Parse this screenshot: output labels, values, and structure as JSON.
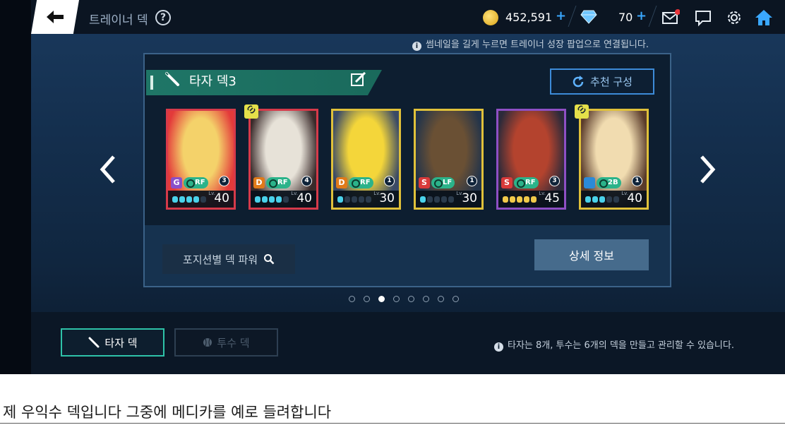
{
  "header": {
    "title": "트레이너 덱",
    "help_icon": "question-circle-icon",
    "coins": "452,591",
    "gems": "70",
    "plus_label": "+",
    "icons": [
      "mail-icon",
      "chat-icon",
      "gear-icon",
      "home-icon"
    ],
    "mail_badge_color": "#e8343a"
  },
  "notice": "썸네일을 길게 누르면 트레이너 성장 팝업으로 연결됩니다.",
  "deck": {
    "name": "타자 덱3",
    "recommend_label": "추천 구성",
    "power_label": "포지션별 덱 파워",
    "detail_label": "상세 정보"
  },
  "cards": [
    {
      "grade": "G",
      "grade_color": "#8a4fc9",
      "position": "RF",
      "level_badge": "3",
      "level": "40",
      "frame_color": "#d63a4a",
      "stars": 4,
      "star_style": "on",
      "linked": false
    },
    {
      "grade": "D",
      "grade_color": "#e07a1a",
      "position": "RF",
      "level_badge": "4",
      "level": "40",
      "frame_color": "#d63a4a",
      "stars": 4,
      "star_style": "on",
      "linked": true
    },
    {
      "grade": "D",
      "grade_color": "#e07a1a",
      "position": "RF",
      "level_badge": "1",
      "level": "30",
      "frame_color": "#e0c13a",
      "stars": 1,
      "star_style": "on",
      "linked": false
    },
    {
      "grade": "S",
      "grade_color": "#d93a3a",
      "position": "LF",
      "level_badge": "1",
      "level": "30",
      "frame_color": "#e0c13a",
      "stars": 1,
      "star_style": "on",
      "linked": false
    },
    {
      "grade": "S",
      "grade_color": "#d93a3a",
      "position": "RF",
      "level_badge": "3",
      "level": "45",
      "frame_color": "#8e4fc4",
      "stars": 5,
      "star_style": "gold",
      "linked": false
    },
    {
      "grade": "",
      "grade_color": "#2b8ad9",
      "position": "2B",
      "level_badge": "1",
      "level": "40",
      "frame_color": "#e0c13a",
      "stars": 3,
      "star_style": "on",
      "linked": true
    }
  ],
  "lv_label": "Lv.",
  "pager": {
    "count": 8,
    "active": 2
  },
  "tabs": {
    "batter_label": "타자 덱",
    "pitcher_label": "투수 덱"
  },
  "bottom_note": "타자는 8개, 투수는 6개의 덱을 만들고 관리할 수 있습니다.",
  "caption": "제 우익수 덱입니다 그중에 메디카를 예로 들려합니다"
}
